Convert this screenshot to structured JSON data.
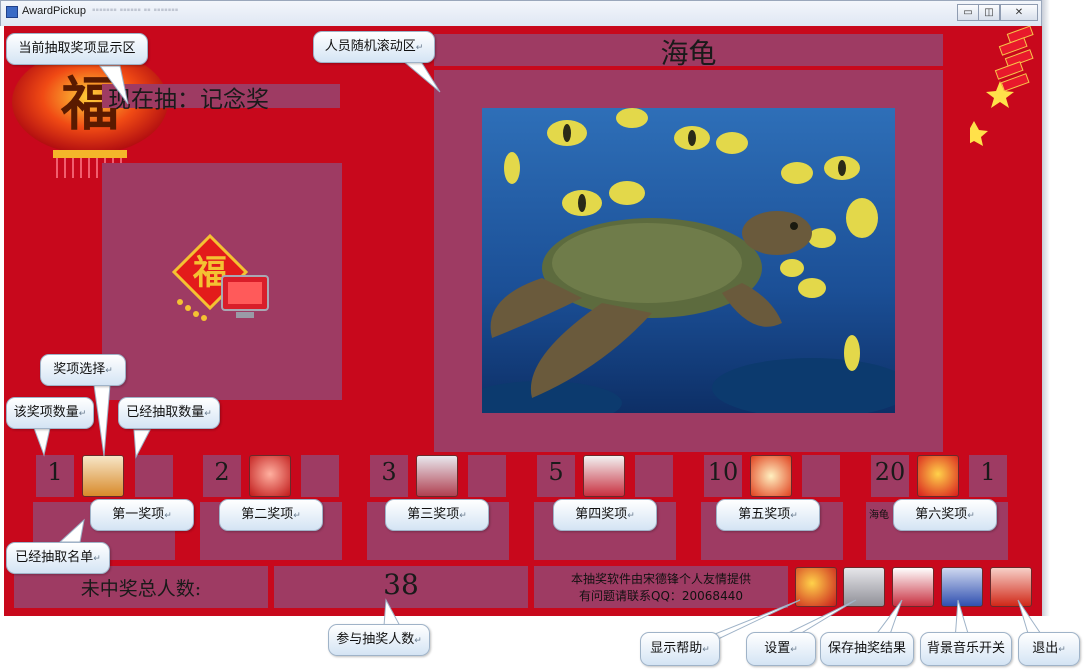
{
  "window": {
    "title": "AwardPickup",
    "buttons": {
      "minimize": "▭",
      "restore": "◫",
      "close": "✕"
    }
  },
  "current_prize": {
    "text": "现在抽：记念奖"
  },
  "person_name": "海龟",
  "tiers": [
    {
      "count": "1",
      "drawn": "",
      "label": "第一奖项",
      "winners": ""
    },
    {
      "count": "2",
      "drawn": "",
      "label": "第二奖项",
      "winners": ""
    },
    {
      "count": "3",
      "drawn": "",
      "label": "第三奖项",
      "winners": ""
    },
    {
      "count": "5",
      "drawn": "",
      "label": "第四奖项",
      "winners": ""
    },
    {
      "count": "10",
      "drawn": "",
      "label": "第五奖项",
      "winners": ""
    },
    {
      "count": "20",
      "drawn": "1",
      "label": "第六奖项",
      "winners": "海龟"
    }
  ],
  "footer": {
    "not_won_label": "未中奖总人数:",
    "participants": "38",
    "credit_line1": "本抽奖软件由宋德锋个人友情提供",
    "credit_line2": "有问题请联系QQ：20068440"
  },
  "callouts": {
    "current_prize_area": "当前抽取奖项显示区",
    "person_scroll_area": "人员随机滚动区",
    "prize_select": "奖项选择",
    "prize_count": "该奖项数量",
    "drawn_count": "已经抽取数量",
    "drawn_list": "已经抽取名单",
    "participants": "参与抽奖人数",
    "help": "显示帮助",
    "settings": "设置",
    "save": "保存抽奖结果",
    "music": "背景音乐开关",
    "exit": "退出"
  },
  "colors": {
    "background": "#c8081c",
    "panel": "#9e3b63",
    "callout": "#d4e4f4"
  }
}
